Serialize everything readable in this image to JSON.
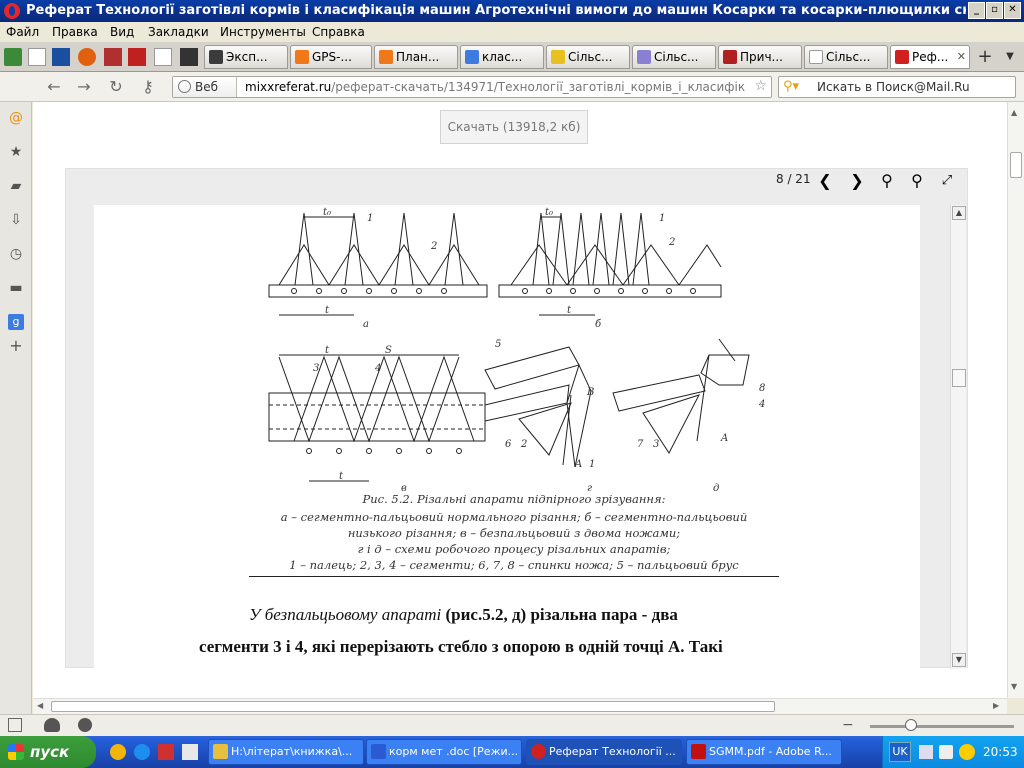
{
  "window": {
    "title": "Реферат Технології заготівлі кормів і класифікація машин Агротехнічні вимоги до машин Косарки та косарки-плющилки ска...",
    "buttons": [
      "_",
      "▫",
      "✕"
    ]
  },
  "menu": [
    "Файл",
    "Правка",
    "Вид",
    "Закладки",
    "Инструменты",
    "Справка"
  ],
  "tabs": [
    {
      "label": "Эксп...",
      "color": "#3b3b3b"
    },
    {
      "label": "GPS-...",
      "color": "#f07818"
    },
    {
      "label": "План...",
      "color": "#f07818"
    },
    {
      "label": "клас...",
      "color": "#3d7be0"
    },
    {
      "label": "Сільс...",
      "color": "#e8c020"
    },
    {
      "label": "Сільс...",
      "color": "#8a7fd0"
    },
    {
      "label": "Прич...",
      "color": "#b02020"
    },
    {
      "label": "Сільс...",
      "color": "#cccccc"
    },
    {
      "label": "Реф...",
      "color": "#d02020"
    }
  ],
  "nav": {
    "web_label": "Веб",
    "url_host": "mixxreferat.ru",
    "url_path": "/реферат-скачать/134971/Технології_заготівлі_кормів_і_класифік",
    "search_placeholder": "Искать в Поиск@Mail.Ru"
  },
  "content": {
    "download_label": "Скачать (13918,2 кб)",
    "page_indicator": "8 / 21"
  },
  "figure": {
    "labels": [
      "t₀",
      "1",
      "2",
      "t",
      "a",
      "t₀",
      "1",
      "2",
      "t",
      "б",
      "t",
      "S",
      "3",
      "4",
      "t",
      "в",
      "5",
      "B",
      "6",
      "2",
      "A",
      "1",
      "г",
      "7",
      "3",
      "A",
      "8",
      "4",
      "д"
    ],
    "caption": [
      "Рис. 5.2. Різальні апарати підпірного зрізування:",
      "а – сегментно-пальцьовий нормального різання; б – сегментно-пальцьовий",
      "низького різання; в – безпальцьовий з двома ножами;",
      "г і д – схеми робочого процесу різальних апаратів;",
      "1 – палець; 2, 3, 4 – сегменти; 6, 7, 8 – спинки ножа; 5 – пальцьовий брус"
    ]
  },
  "text": {
    "line1_italic": "У безпальцьовому апараті",
    "line1_rest": " (рис.5.2, д) різальна пара - два",
    "line2": "сегменти 3 і 4, які перерізають стебло з опорою в одній точці А. Такі"
  },
  "taskbar": {
    "start": "пуск",
    "items": [
      {
        "label": "H:\\літерат\\книжка\\...",
        "color": "#e8c040"
      },
      {
        "label": "корм мет .doc [Режи...",
        "color": "#2a5bd0"
      },
      {
        "label": "Реферат Технології ...",
        "color": "#d02020"
      },
      {
        "label": "SGMM.pdf - Adobe R...",
        "color": "#c01010"
      }
    ],
    "lang": "UK",
    "clock": "20:53"
  }
}
